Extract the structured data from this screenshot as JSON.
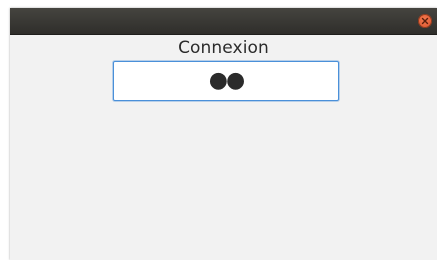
{
  "window": {
    "heading": "Connexion",
    "close_icon": "close-icon"
  },
  "password": {
    "masked_value": "●●"
  },
  "colors": {
    "titlebar": "#3a3935",
    "close_button": "#e25d33",
    "window_bg": "#f2f2f2",
    "focus_border": "#4a90d9"
  }
}
